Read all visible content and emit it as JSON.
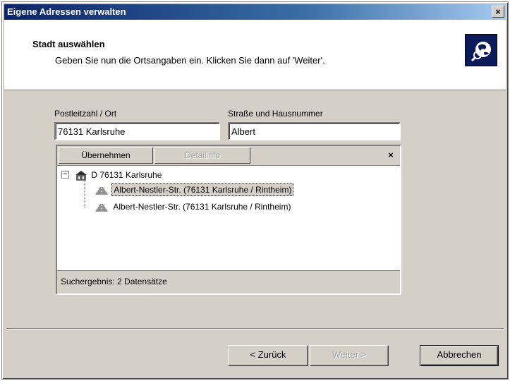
{
  "window": {
    "title": "Eigene Adressen verwalten",
    "close": "×"
  },
  "header": {
    "title": "Stadt auswählen",
    "subtitle": "Geben Sie nun die Ortsangaben ein. Klicken Sie dann auf 'Weiter'."
  },
  "fields": {
    "plz_label": "Postleitzahl / Ort",
    "plz_value": "76131 Karlsruhe",
    "street_label": "Straße und Hausnummer",
    "street_value": "Albert"
  },
  "toolbar": {
    "apply_label": "Übernehmen",
    "detail_label": "Detailinfo",
    "close": "×"
  },
  "tree": {
    "root": "D 76131 Karlsruhe",
    "items": [
      {
        "label": "Albert-Nestler-Str. (76131 Karlsruhe / Rintheim)"
      },
      {
        "label": "Albert-Nestler-Str. (76131 Karlsruhe / Rintheim)"
      }
    ]
  },
  "status": {
    "text": "Suchergebnis: 2 Datensätze"
  },
  "buttons": {
    "back": "< Zurück",
    "next": "Weiter >",
    "cancel": "Abbrechen"
  },
  "colors": {
    "titlebar": "#0a246a",
    "face": "#d4d0c8",
    "logo_bg": "#0b1a5a"
  }
}
